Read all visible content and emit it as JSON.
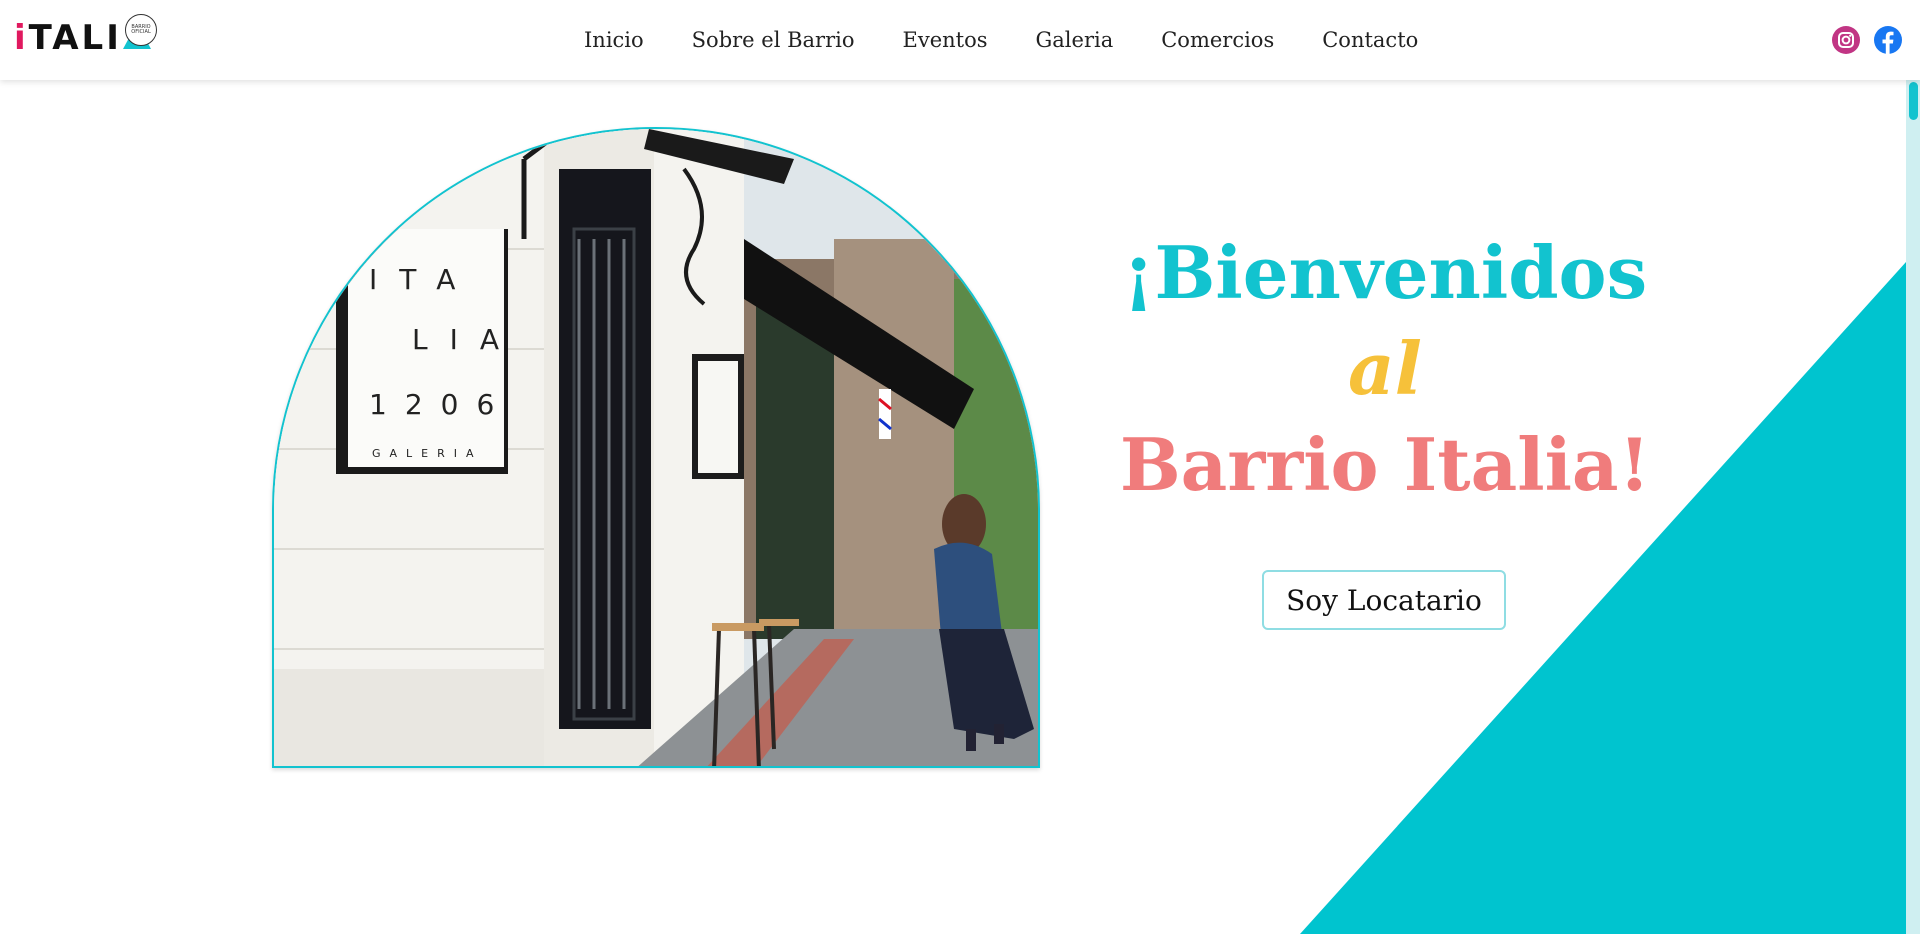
{
  "header": {
    "logo_text": "ITALIA",
    "logo_seal": "BARRIO OFICIAL",
    "nav": [
      "Inicio",
      "Sobre el Barrio",
      "Eventos",
      "Galeria",
      "Comercios",
      "Contacto"
    ],
    "social": [
      {
        "name": "instagram-icon",
        "color": "#c13584"
      },
      {
        "name": "facebook-icon",
        "color": "#1877f2"
      }
    ]
  },
  "hero": {
    "photo_sign": [
      "ITA",
      "LIA",
      "1206",
      "GALERIA"
    ],
    "heading": {
      "line1": "¡Bienvenidos",
      "line2": "al",
      "line3": "Barrio Italia!"
    },
    "cta_label": "Soy Locatario"
  },
  "colors": {
    "accent": "#12c3cf",
    "yellow": "#f6c13a",
    "coral": "#f07c7c"
  }
}
